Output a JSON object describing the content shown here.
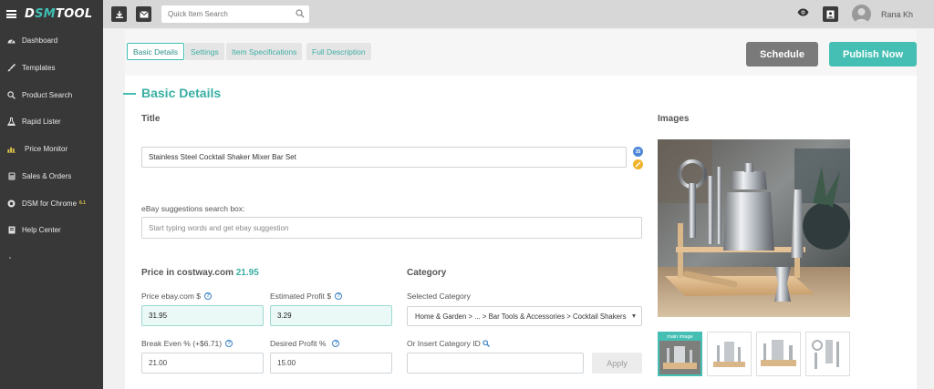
{
  "brand": {
    "logo_left": "D",
    "logo_accent": "SM",
    "logo_right": "TOOL"
  },
  "header": {
    "search_placeholder": "Quick Item Search",
    "username": "Rana Kh"
  },
  "sidebar": {
    "items": [
      {
        "label": "Dashboard",
        "icon": "dashboard-icon"
      },
      {
        "label": "Templates",
        "icon": "brush-icon"
      },
      {
        "label": "Product Search",
        "icon": "search-icon"
      },
      {
        "label": "Rapid Lister",
        "icon": "flask-icon"
      },
      {
        "label": "Price Monitor",
        "icon": "bar-chart-icon"
      },
      {
        "label": "Sales & Orders",
        "icon": "calculator-icon"
      },
      {
        "label": "DSM for Chrome",
        "icon": "chrome-icon",
        "badge": "6.1"
      },
      {
        "label": "Help Center",
        "icon": "book-icon"
      }
    ]
  },
  "tabs": [
    {
      "label": "Basic Details",
      "active": true
    },
    {
      "label": "Settings",
      "active": false
    },
    {
      "label": "Item Specifications",
      "active": false
    },
    {
      "label": "Full Description",
      "active": false
    }
  ],
  "actions": {
    "schedule": "Schedule",
    "publish": "Publish Now"
  },
  "section": {
    "title": "Basic Details"
  },
  "title_block": {
    "label": "Title",
    "value": "Stainless Steel Cocktail Shaker Mixer Bar Set",
    "char_count": "35"
  },
  "suggestions": {
    "label": "eBay suggestions search box:",
    "placeholder": "Start typing words and get ebay suggestion"
  },
  "pricing": {
    "heading_prefix": "Price in costway.com",
    "source_price": "21.95",
    "price_ebay_label": "Price ebay.com $",
    "price_ebay_value": "31.95",
    "profit_label": "Estimated Profit $",
    "profit_value": "3.29",
    "break_even_label": "Break Even % (+$6.71)",
    "break_even_value": "21.00",
    "desired_label": "Desired Profit %",
    "desired_value": "15.00"
  },
  "category": {
    "heading": "Category",
    "selected_label": "Selected Category",
    "selected_value": "Home & Garden > ... > Bar Tools & Accessories > Cocktail Shakers",
    "insert_label": "Or Insert Category ID",
    "insert_value": "",
    "apply_label": "Apply"
  },
  "images": {
    "heading": "Images",
    "main_label": "main image"
  },
  "colors": {
    "accent": "#45bfb3",
    "sidebar_bg": "#383838",
    "topbar_bg": "#d7d7d7",
    "schedule_bg": "#7a7a7a"
  }
}
